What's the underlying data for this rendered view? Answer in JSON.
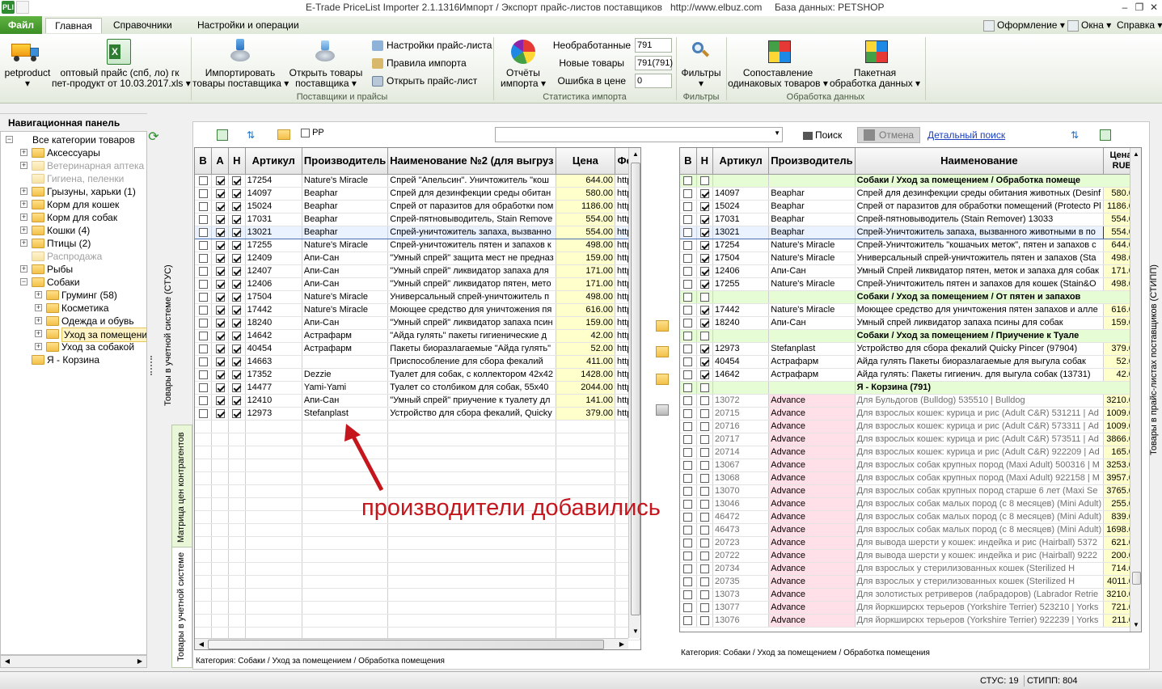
{
  "titlebar": {
    "app_icon": "PLI",
    "title": "E-Trade PriceList Importer 2.1.1316",
    "subtitle": "Импорт / Экспорт прайс-листов поставщиков",
    "url": "http://www.elbuz.com",
    "db": "База данных: PETSHOP"
  },
  "tabs": {
    "file": "Файл",
    "main": "Главная",
    "refs": "Справочники",
    "settings": "Настройки и операции"
  },
  "ribbon_right": {
    "design": "Оформление",
    "windows": "Окна",
    "help": "Справка"
  },
  "ribbon": {
    "petproduct": "petproduct",
    "pricelist_line1": "оптовый прайс (спб, ло) гк",
    "pricelist_line2": "пет-продукт от 10.03.2017.xls",
    "import_line1": "Импортировать",
    "import_line2": "товары поставщика",
    "open_line1": "Открыть товары",
    "open_line2": "поставщика",
    "group_suppliers": "Поставщики и прайсы",
    "price_settings": "Настройки прайс-листа",
    "import_rules": "Правила импорта",
    "open_price": "Открыть прайс-лист",
    "reports_line1": "Отчёты",
    "reports_line2": "импорта",
    "stat_unprocessed_label": "Необработанные",
    "stat_unprocessed_value": "791",
    "stat_new_label": "Новые товары",
    "stat_new_value": "791(791)",
    "stat_error_label": "Ошибка в цене",
    "stat_error_value": "0",
    "group_stats": "Статистика импорта",
    "filters": "Фильтры",
    "group_filters": "Фильтры",
    "match_line1": "Сопоставление",
    "match_line2": "одинаковых товаров",
    "batch_line1": "Пакетная",
    "batch_line2": "обработка данных",
    "group_data": "Обработка данных"
  },
  "nav": {
    "title": "Навигационная панель",
    "items": [
      {
        "label": "Все категории товаров",
        "level": 0,
        "expander": "minus",
        "dim": false
      },
      {
        "label": "Аксессуары",
        "level": 1,
        "expander": "plus",
        "dim": false
      },
      {
        "label": "Ветеринарная аптека",
        "level": 1,
        "expander": "plus",
        "dim": true
      },
      {
        "label": "Гигиена, пеленки",
        "level": 1,
        "expander": "none",
        "dim": true
      },
      {
        "label": "Грызуны, харьки (1)",
        "level": 1,
        "expander": "plus",
        "dim": false
      },
      {
        "label": "Корм для кошек",
        "level": 1,
        "expander": "plus",
        "dim": false
      },
      {
        "label": "Корм для собак",
        "level": 1,
        "expander": "plus",
        "dim": false
      },
      {
        "label": "Кошки (4)",
        "level": 1,
        "expander": "plus",
        "dim": false
      },
      {
        "label": "Птицы (2)",
        "level": 1,
        "expander": "plus",
        "dim": false
      },
      {
        "label": "Распродажа",
        "level": 1,
        "expander": "none",
        "dim": true
      },
      {
        "label": "Рыбы",
        "level": 1,
        "expander": "plus",
        "dim": false
      },
      {
        "label": "Собаки",
        "level": 1,
        "expander": "minus",
        "dim": false
      },
      {
        "label": "Груминг (58)",
        "level": 2,
        "expander": "plus",
        "dim": false
      },
      {
        "label": "Косметика",
        "level": 2,
        "expander": "plus",
        "dim": false
      },
      {
        "label": "Одежда и обувь",
        "level": 2,
        "expander": "plus",
        "dim": false
      },
      {
        "label": "Уход за помещени",
        "level": 2,
        "expander": "plus",
        "dim": false,
        "selected": true
      },
      {
        "label": "Уход за собакой",
        "level": 2,
        "expander": "plus",
        "dim": false
      },
      {
        "label": "Я - Корзина",
        "level": 1,
        "expander": "none",
        "dim": false
      }
    ]
  },
  "vtabs": {
    "stus": "Товары в учетной системе (СТУС)",
    "matrix": "Матрица цен контрагентов",
    "goods": "Товары в учетной системе",
    "stipp": "Товары в прайс-листах поставщиков (СТИПП)"
  },
  "left_toolbar": {
    "pp_label": "PP"
  },
  "search": {
    "button": "Поиск",
    "cancel": "Отмена",
    "advanced": "Детальный поиск",
    "value": ""
  },
  "left_grid": {
    "headers": [
      "В",
      "А",
      "Н",
      "Артикул",
      "Производитель",
      "Наименование №2 (для выгруз",
      "Цена",
      "Фот"
    ],
    "rows": [
      {
        "b": false,
        "a": true,
        "n": true,
        "sku": "17254",
        "maker": "Nature's Miracle",
        "name": "Спрей \"Апельсин\". Уничтожитель \"кош",
        "price": "644.00",
        "photo": "http:/"
      },
      {
        "b": false,
        "a": true,
        "n": true,
        "sku": "14097",
        "maker": "Beaphar",
        "name": "Спрей для дезинфекции среды обитан",
        "price": "580.00",
        "photo": "http:/"
      },
      {
        "b": false,
        "a": true,
        "n": true,
        "sku": "15024",
        "maker": "Beaphar",
        "name": "Спрей от паразитов для обработки пом",
        "price": "1186.00",
        "photo": "http:/"
      },
      {
        "b": false,
        "a": true,
        "n": true,
        "sku": "17031",
        "maker": "Beaphar",
        "name": "Спрей-пятновыводитель, Stain Remove",
        "price": "554.00",
        "photo": "http:/"
      },
      {
        "b": false,
        "a": true,
        "n": true,
        "sku": "13021",
        "maker": "Beaphar",
        "name": "Спрей-уничтожитель запаха, вызванно",
        "price": "554.00",
        "photo": "http:/",
        "selected": true
      },
      {
        "b": false,
        "a": true,
        "n": true,
        "sku": "17255",
        "maker": "Nature's Miracle",
        "name": "Спрей-уничтожитель пятен и запахов к",
        "price": "498.00",
        "photo": "http:/"
      },
      {
        "b": false,
        "a": true,
        "n": true,
        "sku": "12409",
        "maker": "Апи-Сан",
        "name": "\"Умный спрей\" защита мест не предназ",
        "price": "159.00",
        "photo": "http:/"
      },
      {
        "b": false,
        "a": true,
        "n": true,
        "sku": "12407",
        "maker": "Апи-Сан",
        "name": "\"Умный спрей\" ликвидатор запаха для",
        "price": "171.00",
        "photo": "http:/"
      },
      {
        "b": false,
        "a": true,
        "n": true,
        "sku": "12406",
        "maker": "Апи-Сан",
        "name": "\"Умный спрей\" ликвидатор пятен, мето",
        "price": "171.00",
        "photo": "http:/"
      },
      {
        "b": false,
        "a": true,
        "n": true,
        "sku": "17504",
        "maker": "Nature's Miracle",
        "name": "Универсальный спрей-уничтожитель п",
        "price": "498.00",
        "photo": "http:/"
      },
      {
        "b": false,
        "a": true,
        "n": true,
        "sku": "17442",
        "maker": "Nature's Miracle",
        "name": "Моющее средство для уничтожения пя",
        "price": "616.00",
        "photo": "http:/"
      },
      {
        "b": false,
        "a": true,
        "n": true,
        "sku": "18240",
        "maker": "Апи-Сан",
        "name": "\"Умный спрей\" ликвидатор запаха псин",
        "price": "159.00",
        "photo": "http:/"
      },
      {
        "b": false,
        "a": true,
        "n": true,
        "sku": "14642",
        "maker": "Астрафарм",
        "name": "\"Айда гулять\" пакеты гигиенические д",
        "price": "42.00",
        "photo": "http:/"
      },
      {
        "b": false,
        "a": true,
        "n": true,
        "sku": "40454",
        "maker": "Астрафарм",
        "name": "Пакеты биоразлагаемые \"Айда гулять\"",
        "price": "52.00",
        "photo": "http:/"
      },
      {
        "b": false,
        "a": true,
        "n": true,
        "sku": "14663",
        "maker": "",
        "name": "Приспособление для сбора фекалий",
        "price": "411.00",
        "photo": "http:/"
      },
      {
        "b": false,
        "a": true,
        "n": true,
        "sku": "17352",
        "maker": "Dezzie",
        "name": "Туалет для собак, с коллектором 42x42",
        "price": "1428.00",
        "photo": "http:/"
      },
      {
        "b": false,
        "a": true,
        "n": true,
        "sku": "14477",
        "maker": "Yami-Yami",
        "name": "Туалет со столбиком для собак, 55x40",
        "price": "2044.00",
        "photo": "http:/"
      },
      {
        "b": false,
        "a": true,
        "n": true,
        "sku": "12410",
        "maker": "Апи-Сан",
        "name": "\"Умный спрей\" приучение к туалету дл",
        "price": "141.00",
        "photo": "http:/"
      },
      {
        "b": false,
        "a": true,
        "n": true,
        "sku": "12973",
        "maker": "Stefanplast",
        "name": "Устройство для сбора фекалий, Quicky",
        "price": "379.00",
        "photo": "http:/"
      }
    ],
    "category": "Категория: Собаки / Уход за помещением / Обработка помещения"
  },
  "annotation": "производители добавились",
  "right_grid": {
    "headers": [
      "В",
      "Н",
      "Артикул",
      "Производитель",
      "Наименование",
      "Цена, RUB"
    ],
    "rows": [
      {
        "type": "group",
        "b": false,
        "n": false,
        "name": "Собаки / Уход за помещением / Обработка помеще"
      },
      {
        "b": false,
        "n": true,
        "sku": "14097",
        "maker": "Beaphar",
        "name": "Спрей для дезинфекции среды обитания животных (Desinf",
        "price": "580.00"
      },
      {
        "b": false,
        "n": true,
        "sku": "15024",
        "maker": "Beaphar",
        "name": "Спрей от паразитов для обработки помещений (Protecto Pl",
        "price": "1186.00"
      },
      {
        "b": false,
        "n": true,
        "sku": "17031",
        "maker": "Beaphar",
        "name": "Спрей-пятновыводитель (Stain Remover) 13033",
        "price": "554.00"
      },
      {
        "b": false,
        "n": true,
        "sku": "13021",
        "maker": "Beaphar",
        "name": "Спрей-Уничтожитель запаха, вызванного животными в по",
        "price": "554.00",
        "selected": true
      },
      {
        "b": false,
        "n": true,
        "sku": "17254",
        "maker": "Nature's Miracle",
        "name": "Спрей-Уничтожитель \"кошачьих меток\", пятен и запахов с",
        "price": "644.00"
      },
      {
        "b": false,
        "n": true,
        "sku": "17504",
        "maker": "Nature's Miracle",
        "name": "Универсальный спрей-уничтожитель пятен и запахов (Sta",
        "price": "498.00"
      },
      {
        "b": false,
        "n": true,
        "sku": "12406",
        "maker": "Апи-Сан",
        "name": "Умный Спрей ликвидатор пятен, меток и запаха для собак",
        "price": "171.00"
      },
      {
        "b": false,
        "n": true,
        "sku": "17255",
        "maker": "Nature's Miracle",
        "name": "Спрей-Уничтожитель пятен и запахов для кошек (Stain&O",
        "price": "498.00"
      },
      {
        "type": "group",
        "b": false,
        "n": false,
        "name": "Собаки / Уход за помещением / От пятен и запахов"
      },
      {
        "b": false,
        "n": true,
        "sku": "17442",
        "maker": "Nature's Miracle",
        "name": "Моющее средство для уничтожения пятен запахов и алле",
        "price": "616.00"
      },
      {
        "b": false,
        "n": true,
        "sku": "18240",
        "maker": "Апи-Сан",
        "name": "Умный спрей ликвидатор запаха псины для собак",
        "price": "159.00"
      },
      {
        "type": "group",
        "b": false,
        "n": false,
        "name": "Собаки / Уход за помещением / Приучение к Туале"
      },
      {
        "b": false,
        "n": true,
        "sku": "12973",
        "maker": "Stefanplast",
        "name": "Устройство для сбора фекалий Quicky Pincer (97904)",
        "price": "379.00"
      },
      {
        "b": false,
        "n": true,
        "sku": "40454",
        "maker": "Астрафарм",
        "name": "Айда гулять Пакеты биоразлагаемые для выгула собак",
        "price": "52.00"
      },
      {
        "b": false,
        "n": true,
        "sku": "14642",
        "maker": "Астрафарм",
        "name": "Айда гулять: Пакеты гигиенич. для выгула собак (13731)",
        "price": "42.00"
      },
      {
        "type": "group",
        "b": false,
        "n": false,
        "name": "Я - Корзина (791)"
      },
      {
        "b": false,
        "n": false,
        "sku": "13072",
        "maker": "Advance",
        "name": "Для Бульдогов (Bulldog) 535510 | Bulldog",
        "price": "3210.00",
        "dim": true
      },
      {
        "b": false,
        "n": false,
        "sku": "20715",
        "maker": "Advance",
        "name": "Для взрослых кошек: курица и рис (Adult C&R) 531211 | Ad",
        "price": "1009.00",
        "dim": true
      },
      {
        "b": false,
        "n": false,
        "sku": "20716",
        "maker": "Advance",
        "name": "Для взрослых кошек: курица и рис (Adult C&R) 573311 | Ad",
        "price": "1009.00",
        "dim": true
      },
      {
        "b": false,
        "n": false,
        "sku": "20717",
        "maker": "Advance",
        "name": "Для взрослых кошек: курица и рис (Adult C&R) 573511 | Ad",
        "price": "3866.00",
        "dim": true
      },
      {
        "b": false,
        "n": false,
        "sku": "20714",
        "maker": "Advance",
        "name": "Для взрослых кошек: курица и рис (Adult C&R) 922209 | Ad",
        "price": "165.00",
        "dim": true
      },
      {
        "b": false,
        "n": false,
        "sku": "13067",
        "maker": "Advance",
        "name": "Для взрослых собак крупных пород (Maxi Adult) 500316 | M",
        "price": "3253.00",
        "dim": true
      },
      {
        "b": false,
        "n": false,
        "sku": "13068",
        "maker": "Advance",
        "name": "Для взрослых собак крупных пород (Maxi Adult) 922158 | M",
        "price": "3957.00",
        "dim": true
      },
      {
        "b": false,
        "n": false,
        "sku": "13070",
        "maker": "Advance",
        "name": "Для взрослых собак крупных пород старше 6 лет (Maxi Se",
        "price": "3765.00",
        "dim": true
      },
      {
        "b": false,
        "n": false,
        "sku": "13046",
        "maker": "Advance",
        "name": "Для взрослых собак малых пород (с 8 месяцев) (Mini Adult)",
        "price": "255.00",
        "dim": true
      },
      {
        "b": false,
        "n": false,
        "sku": "46472",
        "maker": "Advance",
        "name": "Для взрослых собак малых пород (с 8 месяцев) (Mini Adult)",
        "price": "839.00",
        "dim": true
      },
      {
        "b": false,
        "n": false,
        "sku": "46473",
        "maker": "Advance",
        "name": "Для взрослых собак малых пород (с 8 месяцев) (Mini Adult)",
        "price": "1698.00",
        "dim": true
      },
      {
        "b": false,
        "n": false,
        "sku": "20723",
        "maker": "Advance",
        "name": "Для вывода шерсти у кошек: индейка и рис (Hairball) 5372",
        "price": "621.00",
        "dim": true
      },
      {
        "b": false,
        "n": false,
        "sku": "20722",
        "maker": "Advance",
        "name": "Для вывода шерсти у кошек: индейка и рис (Hairball) 9222",
        "price": "200.00",
        "dim": true
      },
      {
        "b": false,
        "n": false,
        "sku": "20734",
        "maker": "Advance",
        "name": "Для взрослых у стерилизованных кошек (Sterilized H",
        "price": "714.00",
        "dim": true
      },
      {
        "b": false,
        "n": false,
        "sku": "20735",
        "maker": "Advance",
        "name": "Для взрослых у стерилизованных кошек (Sterilized H",
        "price": "4011.00",
        "dim": true
      },
      {
        "b": false,
        "n": false,
        "sku": "13073",
        "maker": "Advance",
        "name": "Для золотистых ретриверов (лабрадоров) (Labrador Retrie",
        "price": "3210.00",
        "dim": true
      },
      {
        "b": false,
        "n": false,
        "sku": "13077",
        "maker": "Advance",
        "name": "Для йоркширскх терьеров (Yorkshire Terrier) 523210 | Yorks",
        "price": "721.00",
        "dim": true
      },
      {
        "b": false,
        "n": false,
        "sku": "13076",
        "maker": "Advance",
        "name": "Для йоркширскх терьеров (Yorkshire Terrier) 922239 | Yorks",
        "price": "211.00",
        "dim": true
      }
    ],
    "category": "Категория: Собаки / Уход за помещением / Обработка помещения"
  },
  "status": {
    "stus": "СТУС: 19",
    "stipp": "СТИПП: 804"
  },
  "colors": {
    "price_bg": "#ffffcc",
    "group_bg": "#e5fcd5",
    "pink_bg": "#ffdfe8",
    "annotation": "#c4161c",
    "file_tab": "#4ea233"
  }
}
